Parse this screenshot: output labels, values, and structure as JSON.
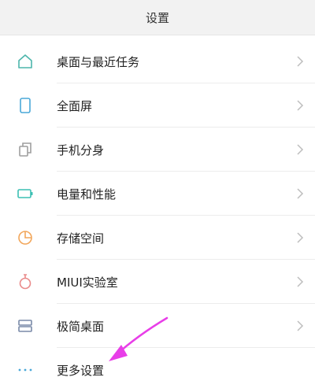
{
  "header": {
    "title": "设置"
  },
  "items": [
    {
      "label": "桌面与最近任务",
      "icon": "home-icon",
      "color": "#4db6ac"
    },
    {
      "label": "全面屏",
      "icon": "phone-icon",
      "color": "#4aa8d8"
    },
    {
      "label": "手机分身",
      "icon": "clone-icon",
      "color": "#9e9e9e"
    },
    {
      "label": "电量和性能",
      "icon": "battery-icon",
      "color": "#3bbfb3"
    },
    {
      "label": "存储空间",
      "icon": "pie-icon",
      "color": "#f2a65a"
    },
    {
      "label": "MIUI实验室",
      "icon": "flask-icon",
      "color": "#e98a8a"
    },
    {
      "label": "极简桌面",
      "icon": "layout-icon",
      "color": "#7a8aa8"
    },
    {
      "label": "更多设置",
      "icon": "more-icon",
      "color": "#4aa8d8"
    }
  ],
  "annotation": {
    "color": "#e83ee8"
  }
}
